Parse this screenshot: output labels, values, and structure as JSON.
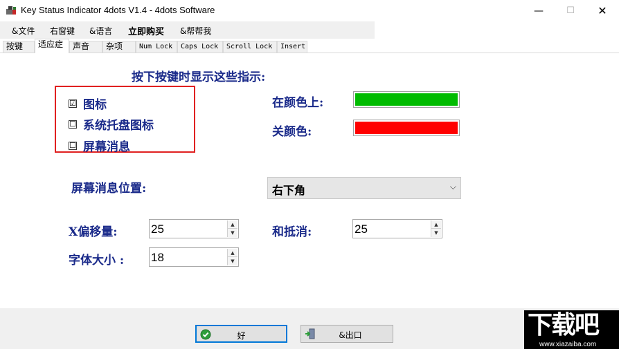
{
  "window": {
    "title": "Key Status Indicator 4dots V1.4 - 4dots Software",
    "minimize": "—",
    "maximize": "☐",
    "close": "✕"
  },
  "menu": {
    "items": [
      "&文件",
      "右窗键",
      "&语言",
      "立即购买",
      "&帮帮我"
    ]
  },
  "tabs": {
    "items": [
      "按键",
      "适应症",
      "声音",
      "杂项",
      "Num Lock",
      "Caps Lock",
      "Scroll Lock",
      "Insert"
    ],
    "active_index": 1
  },
  "panel": {
    "heading": "按下按键时显示这些指示:",
    "checkboxes": [
      {
        "label": "图标",
        "checked": true,
        "mark": "☑"
      },
      {
        "label": "系统托盘图标",
        "checked": false,
        "mark": "☐"
      },
      {
        "label": "屏幕消息",
        "checked": false,
        "mark": "☐"
      }
    ],
    "on_color_label": "在颜色上:",
    "off_color_label": "关颜色:",
    "on_color": "#00bb00",
    "off_color": "#ff0000",
    "position_label": "屏幕消息位置:",
    "position_value": "右下角",
    "x_offset_label": "X偏移量:",
    "x_offset_value": "25",
    "y_offset_label": "和抵消:",
    "y_offset_value": "25",
    "font_size_label": "字体大小 :",
    "font_size_value": "18"
  },
  "footer": {
    "ok_label": "好",
    "exit_label": "&出口"
  },
  "watermark": {
    "big": "下载吧",
    "small": "www.xiazaiba.com"
  },
  "icons": {
    "spin_up": "▲",
    "spin_down": "▼",
    "dropdown": "⌵"
  }
}
